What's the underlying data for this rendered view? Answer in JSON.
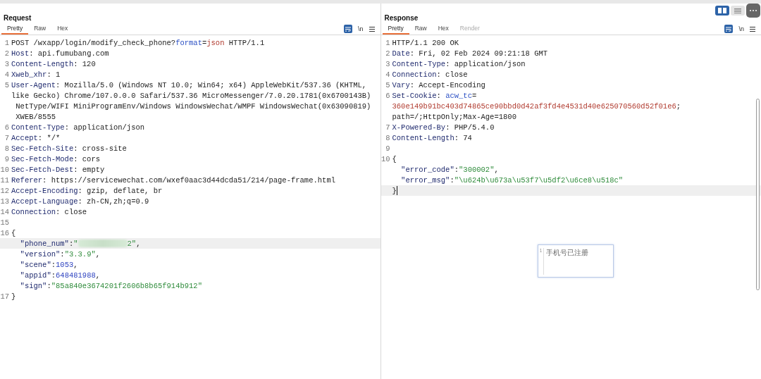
{
  "view_modes": [
    {
      "kind": "split",
      "selected": true
    },
    {
      "kind": "list",
      "selected": false
    }
  ],
  "panes": [
    {
      "title": "Request",
      "tabs": [
        {
          "label": "Pretty",
          "selected": true,
          "disabled": false
        },
        {
          "label": "Raw",
          "selected": false,
          "disabled": false
        },
        {
          "label": "Hex",
          "selected": false,
          "disabled": false
        }
      ],
      "newline_toggle": "\\n",
      "lines": [
        {
          "number": "1",
          "highlighted": false,
          "segments": [
            {
              "kind": "plain",
              "text": "POST /wxapp/login/modify_check_phone?"
            },
            {
              "kind": "param",
              "text": "format"
            },
            {
              "kind": "plain",
              "text": "="
            },
            {
              "kind": "value",
              "text": "json"
            },
            {
              "kind": "plain",
              "text": " HTTP/1.1"
            }
          ]
        },
        {
          "number": "2",
          "highlighted": false,
          "segments": [
            {
              "kind": "key",
              "text": "Host"
            },
            {
              "kind": "plain",
              "text": ": api.fumubang.com"
            }
          ]
        },
        {
          "number": "3",
          "highlighted": false,
          "segments": [
            {
              "kind": "key",
              "text": "Content-Length"
            },
            {
              "kind": "plain",
              "text": ": 120"
            }
          ]
        },
        {
          "number": "4",
          "highlighted": false,
          "segments": [
            {
              "kind": "key",
              "text": "Xweb_xhr"
            },
            {
              "kind": "plain",
              "text": ": 1"
            }
          ]
        },
        {
          "number": "5",
          "highlighted": false,
          "segments": [
            {
              "kind": "key",
              "text": "User-Agent"
            },
            {
              "kind": "plain",
              "text": ": Mozilla/5.0 (Windows NT 10.0; Win64; x64) AppleWebKit/537.36 (KHTML,"
            }
          ]
        },
        {
          "highlighted": false,
          "segments": [
            {
              "kind": "plain",
              "text": "like Gecko) Chrome/107.0.0.0 Safari/537.36 MicroMessenger/7.0.20.1781(0x6700143B)"
            }
          ]
        },
        {
          "highlighted": false,
          "segments": [
            {
              "kind": "plain",
              "text": " NetType/WIFI MiniProgramEnv/Windows WindowsWechat/WMPF WindowsWechat(0x63090819)"
            }
          ]
        },
        {
          "highlighted": false,
          "segments": [
            {
              "kind": "plain",
              "text": " XWEB/8555"
            }
          ]
        },
        {
          "number": "6",
          "highlighted": false,
          "segments": [
            {
              "kind": "key",
              "text": "Content-Type"
            },
            {
              "kind": "plain",
              "text": ": application/json"
            }
          ]
        },
        {
          "number": "7",
          "highlighted": false,
          "segments": [
            {
              "kind": "key",
              "text": "Accept"
            },
            {
              "kind": "plain",
              "text": ": */*"
            }
          ]
        },
        {
          "number": "8",
          "highlighted": false,
          "segments": [
            {
              "kind": "key",
              "text": "Sec-Fetch-Site"
            },
            {
              "kind": "plain",
              "text": ": cross-site"
            }
          ]
        },
        {
          "number": "9",
          "highlighted": false,
          "segments": [
            {
              "kind": "key",
              "text": "Sec-Fetch-Mode"
            },
            {
              "kind": "plain",
              "text": ": cors"
            }
          ]
        },
        {
          "number": "10",
          "highlighted": false,
          "segments": [
            {
              "kind": "key",
              "text": "Sec-Fetch-Dest"
            },
            {
              "kind": "plain",
              "text": ": empty"
            }
          ]
        },
        {
          "number": "11",
          "highlighted": false,
          "segments": [
            {
              "kind": "key",
              "text": "Referer"
            },
            {
              "kind": "plain",
              "text": ": https://servicewechat.com/wxef0aac3d44dcda51/214/page-frame.html"
            }
          ]
        },
        {
          "number": "12",
          "highlighted": false,
          "segments": [
            {
              "kind": "key",
              "text": "Accept-Encoding"
            },
            {
              "kind": "plain",
              "text": ": gzip, deflate, br"
            }
          ]
        },
        {
          "number": "13",
          "highlighted": false,
          "segments": [
            {
              "kind": "key",
              "text": "Accept-Language"
            },
            {
              "kind": "plain",
              "text": ": zh-CN,zh;q=0.9"
            }
          ]
        },
        {
          "number": "14",
          "highlighted": false,
          "segments": [
            {
              "kind": "key",
              "text": "Connection"
            },
            {
              "kind": "plain",
              "text": ": close"
            }
          ]
        },
        {
          "number": "15",
          "highlighted": false
        },
        {
          "number": "16",
          "highlighted": false,
          "segments": [
            {
              "kind": "plain",
              "text": "{"
            }
          ]
        },
        {
          "highlighted": true,
          "segments": [
            {
              "kind": "key",
              "text": "  \"phone_num\""
            },
            {
              "kind": "plain",
              "text": ":"
            },
            {
              "kind": "string",
              "text": "\""
            },
            {
              "kind": "redacted"
            },
            {
              "kind": "string",
              "text": "2\""
            },
            {
              "kind": "plain",
              "text": ","
            }
          ]
        },
        {
          "highlighted": false,
          "segments": [
            {
              "kind": "key",
              "text": "  \"version\""
            },
            {
              "kind": "plain",
              "text": ":"
            },
            {
              "kind": "string",
              "text": "\"3.3.9\""
            },
            {
              "kind": "plain",
              "text": ","
            }
          ]
        },
        {
          "highlighted": false,
          "segments": [
            {
              "kind": "key",
              "text": "  \"scene\""
            },
            {
              "kind": "plain",
              "text": ":"
            },
            {
              "kind": "number",
              "text": "1053"
            },
            {
              "kind": "plain",
              "text": ","
            }
          ]
        },
        {
          "highlighted": false,
          "segments": [
            {
              "kind": "key",
              "text": "  \"appid\""
            },
            {
              "kind": "plain",
              "text": ":"
            },
            {
              "kind": "number",
              "text": "648481988"
            },
            {
              "kind": "plain",
              "text": ","
            }
          ]
        },
        {
          "highlighted": false,
          "segments": [
            {
              "kind": "key",
              "text": "  \"sign\""
            },
            {
              "kind": "plain",
              "text": ":"
            },
            {
              "kind": "string",
              "text": "\"85a840e3674201f2606b8b65f914b912\""
            }
          ]
        },
        {
          "number": "17",
          "highlighted": false,
          "segments": [
            {
              "kind": "plain",
              "text": "}"
            }
          ]
        }
      ]
    },
    {
      "title": "Response",
      "tabs": [
        {
          "label": "Pretty",
          "selected": true,
          "disabled": false
        },
        {
          "label": "Raw",
          "selected": false,
          "disabled": false
        },
        {
          "label": "Hex",
          "selected": false,
          "disabled": false
        },
        {
          "label": "Render",
          "selected": false,
          "disabled": true
        }
      ],
      "newline_toggle": "\\n",
      "scrollbar": true,
      "lines": [
        {
          "number": "1",
          "highlighted": false,
          "segments": [
            {
              "kind": "plain",
              "text": "HTTP/1.1 200 OK"
            }
          ]
        },
        {
          "number": "2",
          "highlighted": false,
          "segments": [
            {
              "kind": "key",
              "text": "Date"
            },
            {
              "kind": "plain",
              "text": ": Fri, 02 Feb 2024 09:21:18 GMT"
            }
          ]
        },
        {
          "number": "3",
          "highlighted": false,
          "segments": [
            {
              "kind": "key",
              "text": "Content-Type"
            },
            {
              "kind": "plain",
              "text": ": application/json"
            }
          ]
        },
        {
          "number": "4",
          "highlighted": false,
          "segments": [
            {
              "kind": "key",
              "text": "Connection"
            },
            {
              "kind": "plain",
              "text": ": close"
            }
          ]
        },
        {
          "number": "5",
          "highlighted": false,
          "segments": [
            {
              "kind": "key",
              "text": "Vary"
            },
            {
              "kind": "plain",
              "text": ": Accept-Encoding"
            }
          ]
        },
        {
          "number": "6",
          "highlighted": false,
          "segments": [
            {
              "kind": "key",
              "text": "Set-Cookie"
            },
            {
              "kind": "plain",
              "text": ": "
            },
            {
              "kind": "param",
              "text": "acw_tc"
            },
            {
              "kind": "plain",
              "text": "="
            }
          ]
        },
        {
          "highlighted": false,
          "segments": [
            {
              "kind": "value",
              "text": "360e149b91bc403d74865ce90bbd0d42af3fd4e4531d40e625070560d52f01e6"
            },
            {
              "kind": "plain",
              "text": ";"
            }
          ]
        },
        {
          "highlighted": false,
          "segments": [
            {
              "kind": "plain",
              "text": "path=/;HttpOnly;Max-Age=1800"
            }
          ]
        },
        {
          "number": "7",
          "highlighted": false,
          "segments": [
            {
              "kind": "key",
              "text": "X-Powered-By"
            },
            {
              "kind": "plain",
              "text": ": PHP/5.4.0"
            }
          ]
        },
        {
          "number": "8",
          "highlighted": false,
          "segments": [
            {
              "kind": "key",
              "text": "Content-Length"
            },
            {
              "kind": "plain",
              "text": ": 74"
            }
          ]
        },
        {
          "number": "9",
          "highlighted": false
        },
        {
          "number": "10",
          "highlighted": false,
          "segments": [
            {
              "kind": "plain",
              "text": "{"
            }
          ]
        },
        {
          "highlighted": false,
          "segments": [
            {
              "kind": "key",
              "text": "  \"error_code\""
            },
            {
              "kind": "plain",
              "text": ":"
            },
            {
              "kind": "string",
              "text": "\"300002\""
            },
            {
              "kind": "plain",
              "text": ","
            }
          ]
        },
        {
          "highlighted": false,
          "segments": [
            {
              "kind": "key",
              "text": "  \"error_msg\""
            },
            {
              "kind": "plain",
              "text": ":"
            },
            {
              "kind": "string",
              "text": "\"\\u624b\\u673a\\u53f7\\u5df2\\u6ce8\\u518c\""
            }
          ]
        },
        {
          "highlighted": true,
          "segments": [
            {
              "kind": "plain",
              "text": "}"
            },
            {
              "kind": "cursor"
            }
          ]
        }
      ],
      "popup": {
        "line_number": "1",
        "text": "手机号已注册"
      }
    }
  ]
}
